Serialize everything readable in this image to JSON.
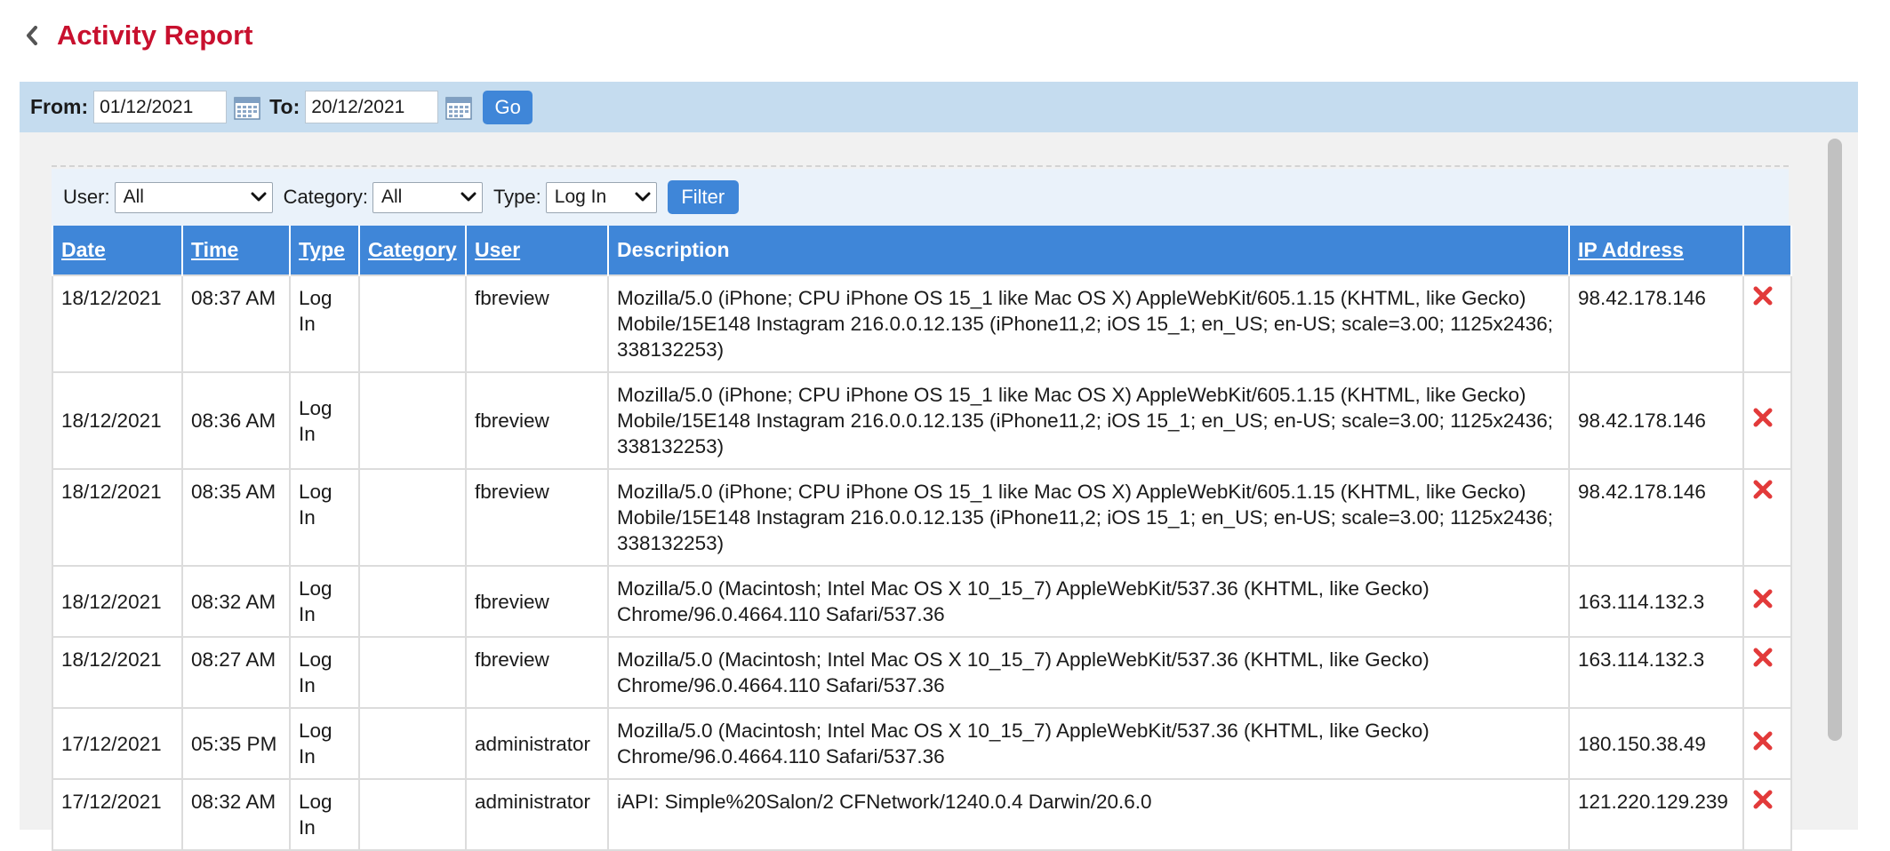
{
  "page": {
    "title": "Activity Report"
  },
  "date_range": {
    "from_label": "From:",
    "from_value": "01/12/2021",
    "to_label": "To:",
    "to_value": "20/12/2021",
    "go_label": "Go"
  },
  "filters": {
    "user_label": "User:",
    "user_value": "All",
    "category_label": "Category:",
    "category_value": "All",
    "type_label": "Type:",
    "type_value": "Log In",
    "filter_label": "Filter"
  },
  "table": {
    "headers": {
      "date": "Date",
      "time": "Time",
      "type": "Type",
      "category": "Category",
      "user": "User",
      "description": "Description",
      "ip": "IP Address"
    },
    "rows": [
      {
        "date": "18/12/2021",
        "time": "08:37 AM",
        "type": "Log In",
        "category": "",
        "user": "fbreview",
        "description": "Mozilla/5.0 (iPhone; CPU iPhone OS 15_1 like Mac OS X) AppleWebKit/605.1.15 (KHTML, like Gecko) Mobile/15E148 Instagram 216.0.0.12.135 (iPhone11,2; iOS 15_1; en_US; en-US; scale=3.00; 1125x2436; 338132253)",
        "ip": "98.42.178.146"
      },
      {
        "date": "18/12/2021",
        "time": "08:36 AM",
        "type": "Log In",
        "category": "",
        "user": "fbreview",
        "description": "Mozilla/5.0 (iPhone; CPU iPhone OS 15_1 like Mac OS X) AppleWebKit/605.1.15 (KHTML, like Gecko) Mobile/15E148 Instagram 216.0.0.12.135 (iPhone11,2; iOS 15_1; en_US; en-US; scale=3.00; 1125x2436; 338132253)",
        "ip": "98.42.178.146"
      },
      {
        "date": "18/12/2021",
        "time": "08:35 AM",
        "type": "Log In",
        "category": "",
        "user": "fbreview",
        "description": "Mozilla/5.0 (iPhone; CPU iPhone OS 15_1 like Mac OS X) AppleWebKit/605.1.15 (KHTML, like Gecko) Mobile/15E148 Instagram 216.0.0.12.135 (iPhone11,2; iOS 15_1; en_US; en-US; scale=3.00; 1125x2436; 338132253)",
        "ip": "98.42.178.146"
      },
      {
        "date": "18/12/2021",
        "time": "08:32 AM",
        "type": "Log In",
        "category": "",
        "user": "fbreview",
        "description": "Mozilla/5.0 (Macintosh; Intel Mac OS X 10_15_7) AppleWebKit/537.36 (KHTML, like Gecko) Chrome/96.0.4664.110 Safari/537.36",
        "ip": "163.114.132.3"
      },
      {
        "date": "18/12/2021",
        "time": "08:27 AM",
        "type": "Log In",
        "category": "",
        "user": "fbreview",
        "description": "Mozilla/5.0 (Macintosh; Intel Mac OS X 10_15_7) AppleWebKit/537.36 (KHTML, like Gecko) Chrome/96.0.4664.110 Safari/537.36",
        "ip": "163.114.132.3"
      },
      {
        "date": "17/12/2021",
        "time": "05:35 PM",
        "type": "Log In",
        "category": "",
        "user": "administrator",
        "description": "Mozilla/5.0 (Macintosh; Intel Mac OS X 10_15_7) AppleWebKit/537.36 (KHTML, like Gecko) Chrome/96.0.4664.110 Safari/537.36",
        "ip": "180.150.38.49"
      },
      {
        "date": "17/12/2021",
        "time": "08:32 AM",
        "type": "Log In",
        "category": "",
        "user": "administrator",
        "description": "iAPI: Simple%20Salon/2 CFNetwork/1240.0.4 Darwin/20.6.0",
        "ip": "121.220.129.239"
      }
    ]
  },
  "icons": {
    "back": "chevron-left-icon",
    "calendar": "calendar-icon",
    "dropdown": "chevron-down-icon",
    "delete": "delete-x-icon"
  },
  "colors": {
    "title": "#c8102e",
    "accent": "#3f86d8",
    "date_bar": "#c5dcef",
    "filter_bar": "#eaf2fa",
    "delete": "#e23a3a"
  }
}
